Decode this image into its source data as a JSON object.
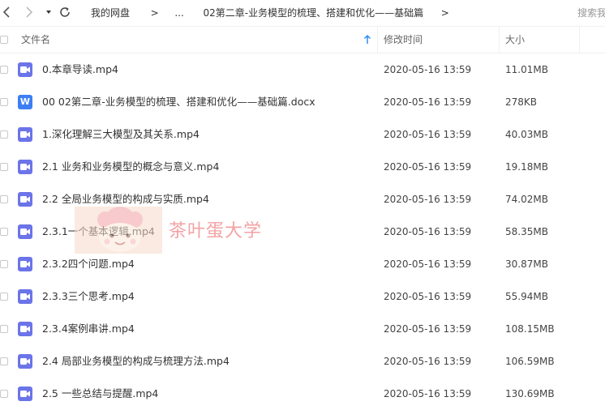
{
  "toolbar": {
    "back_icon": "chevron-left-icon",
    "forward_icon": "chevron-right-icon",
    "history_icon": "caret-down-icon",
    "refresh_icon": "refresh-icon"
  },
  "breadcrumb": {
    "items": [
      "我的网盘",
      ">",
      "...",
      "02第二章-业务模型的梳理、搭建和优化——基础篇",
      ">"
    ]
  },
  "search": {
    "placeholder": "搜索我"
  },
  "table": {
    "headers": {
      "name": "文件名",
      "modified": "修改时间",
      "size": "大小"
    },
    "sort_icon": "arrow-up-icon",
    "rows": [
      {
        "name": "0.本章导读.mp4",
        "date": "2020-05-16 13:59",
        "size": "11.01MB",
        "type": "video"
      },
      {
        "name": "00  02第二章-业务模型的梳理、搭建和优化——基础篇.docx",
        "date": "2020-05-16 13:59",
        "size": "278KB",
        "type": "word",
        "icon_letter": "W"
      },
      {
        "name": "1.深化理解三大模型及其关系.mp4",
        "date": "2020-05-16 13:59",
        "size": "40.03MB",
        "type": "video"
      },
      {
        "name": "2.1 业务和业务模型的概念与意义.mp4",
        "date": "2020-05-16 13:59",
        "size": "19.18MB",
        "type": "video"
      },
      {
        "name": "2.2 全局业务模型的构成与实质.mp4",
        "date": "2020-05-16 13:59",
        "size": "74.02MB",
        "type": "video"
      },
      {
        "name": "2.3.1一个基本逻辑.mp4",
        "date": "2020-05-16 13:59",
        "size": "58.35MB",
        "type": "video"
      },
      {
        "name": "2.3.2四个问题.mp4",
        "date": "2020-05-16 13:59",
        "size": "30.87MB",
        "type": "video"
      },
      {
        "name": "2.3.3三个思考.mp4",
        "date": "2020-05-16 13:59",
        "size": "55.94MB",
        "type": "video"
      },
      {
        "name": "2.3.4案例串讲.mp4",
        "date": "2020-05-16 13:59",
        "size": "108.15MB",
        "type": "video"
      },
      {
        "name": "2.4 局部业务模型的构成与梳理方法.mp4",
        "date": "2020-05-16 13:59",
        "size": "106.59MB",
        "type": "video"
      },
      {
        "name": "2.5 一些总结与提醒.mp4",
        "date": "2020-05-16 13:59",
        "size": "130.69MB",
        "type": "video"
      }
    ]
  },
  "watermark": {
    "text": "茶叶蛋大学",
    "icon": "cartoon-face-logo"
  },
  "colors": {
    "video_icon": "#6b74e8",
    "word_icon": "#3d7ef5",
    "sort_arrow": "#2e8df5",
    "watermark": "#f3a2a4"
  }
}
